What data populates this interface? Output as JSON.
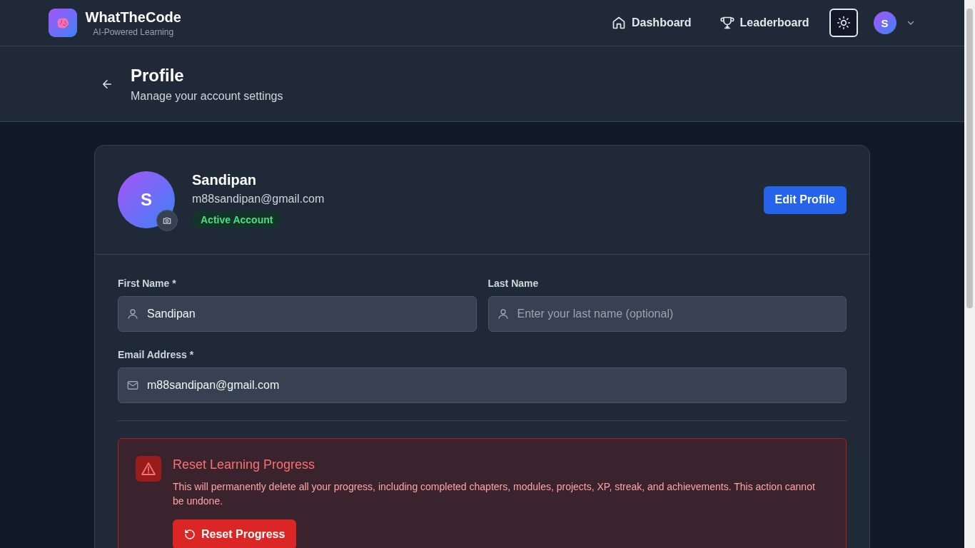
{
  "brand": {
    "name": "WhatTheCode",
    "tagline": "AI-Powered Learning"
  },
  "nav": [
    {
      "label": "Dashboard",
      "kind": "home"
    },
    {
      "label": "Leaderboard",
      "kind": "trophy"
    }
  ],
  "user_menu": {
    "initial": "S"
  },
  "page": {
    "title": "Profile",
    "subtitle": "Manage your account settings"
  },
  "profile": {
    "initial": "S",
    "name": "Sandipan",
    "email": "m88sandipan@gmail.com",
    "status": "Active Account",
    "edit_button": "Edit Profile"
  },
  "fields": [
    {
      "label": "First Name *",
      "kind": "person",
      "value": "Sandipan"
    },
    {
      "label": "Last Name",
      "kind": "person",
      "placeholder": "Enter your last name (optional)"
    },
    {
      "label": "Email Address *",
      "kind": "email",
      "value": "m88sandipan@gmail.com"
    }
  ],
  "danger": {
    "title": "Reset Learning Progress",
    "text": "This will permanently delete all your progress, including completed chapters, modules, projects, XP, streak, and achievements. This action cannot be undone.",
    "button": "Reset Progress"
  }
}
